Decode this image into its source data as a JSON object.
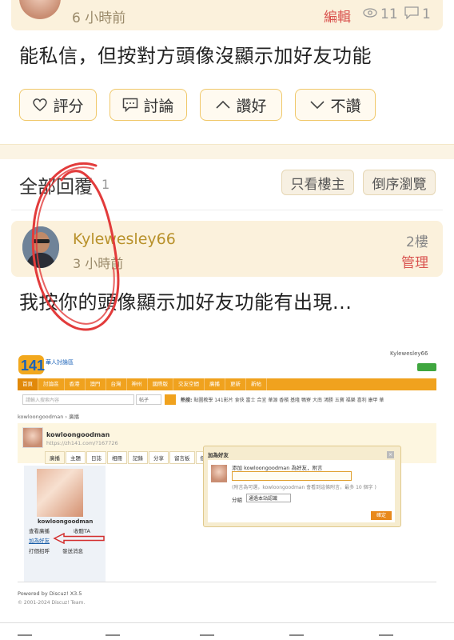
{
  "post": {
    "time": "6 小時前",
    "edit_label": "編輯",
    "views": "11",
    "comments": "1",
    "text": "能私信，但按對方頭像沒顯示加好友功能",
    "actions": {
      "rate": "評分",
      "discuss": "討論",
      "like": "讚好",
      "dislike": "不讚"
    }
  },
  "replies_header": {
    "title": "全部回覆",
    "count": "1",
    "only_op": "只看樓主",
    "reverse": "倒序瀏覽"
  },
  "reply": {
    "username": "Kylewesley66",
    "time": "3 小時前",
    "floor": "2樓",
    "manage": "管理",
    "text": "我按你的頭像顯示加好友功能有出現..."
  },
  "screenshot": {
    "logo_text": "141",
    "logo_sub": "華人討論區",
    "header_user": "Kylewesley66",
    "nav": [
      "首頁",
      "討論區",
      "香港",
      "澳門",
      "台灣",
      "神州",
      "國際版",
      "交友空間",
      "廣播",
      "更新",
      "新帖"
    ],
    "search_placeholder": "請輸入搜索內容",
    "search_scope": "帖子",
    "hot_label": "熱搜:",
    "hot_terms": "貼圖教學 141影片 食俠 富士 合宜 華源 香檳 基隆 鴨寮 大南 鴻勝 五寶 福樂 喜利 康甲 華",
    "breadcrumb": "kowloongoodman › 廣播",
    "profile_name": "kowloongoodman",
    "profile_url": "https://zh141.com/?167726",
    "tabs": [
      "廣播",
      "主題",
      "日誌",
      "相冊",
      "記錄",
      "分享",
      "留言板",
      "個人"
    ],
    "side_name": "kowloongoodman",
    "side_links": [
      "查看廣播",
      "收聽TA",
      "加為好友",
      "打個招呼",
      "發送消息"
    ],
    "dialog": {
      "title": "加為好友",
      "line1": "添加 kowloongoodman 為好友，附言",
      "note": "(附言為可選，kowloongoodman 會看到這條附言，最多 10 個字 )",
      "group_label": "分組",
      "group_value": "通過本站認識",
      "ok": "確定"
    },
    "powered": "Powered by Discuz! X3.5",
    "copyright": "© 2001-2024 Discuz! Team."
  },
  "colors": {
    "accent": "#f0a21e",
    "annotation_red": "#e23b3b",
    "username": "#b8912a",
    "header_bg": "#fbf1dc"
  }
}
